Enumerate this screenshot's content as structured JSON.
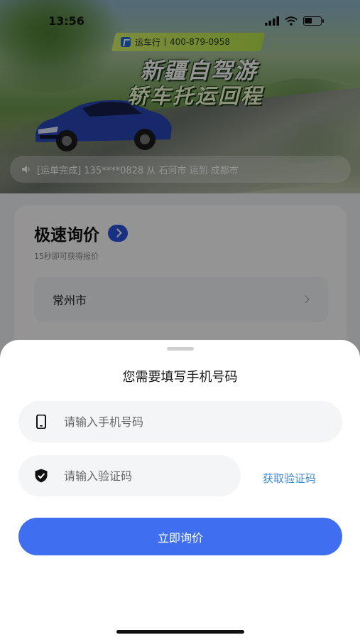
{
  "status_bar": {
    "time": "13:56"
  },
  "banner": {
    "brand": "运车行",
    "hotline": "400-879-0958",
    "headline": "新疆自驾游",
    "subline": "轿车托运回程",
    "ticker": "[运单完成] 135****0828 从 石河市 运到 成都市"
  },
  "quote_card": {
    "title": "极速询价",
    "subtitle": "15秒即可获得报价",
    "city": "常州市"
  },
  "sheet": {
    "title": "您需要填写手机号码",
    "phone_placeholder": "请输入手机号码",
    "code_placeholder": "请输入验证码",
    "get_code_label": "获取验证码",
    "submit_label": "立即询价"
  },
  "colors": {
    "accent": "#3f6ff0",
    "link": "#3d86d8",
    "badge": "#2b55e0"
  }
}
